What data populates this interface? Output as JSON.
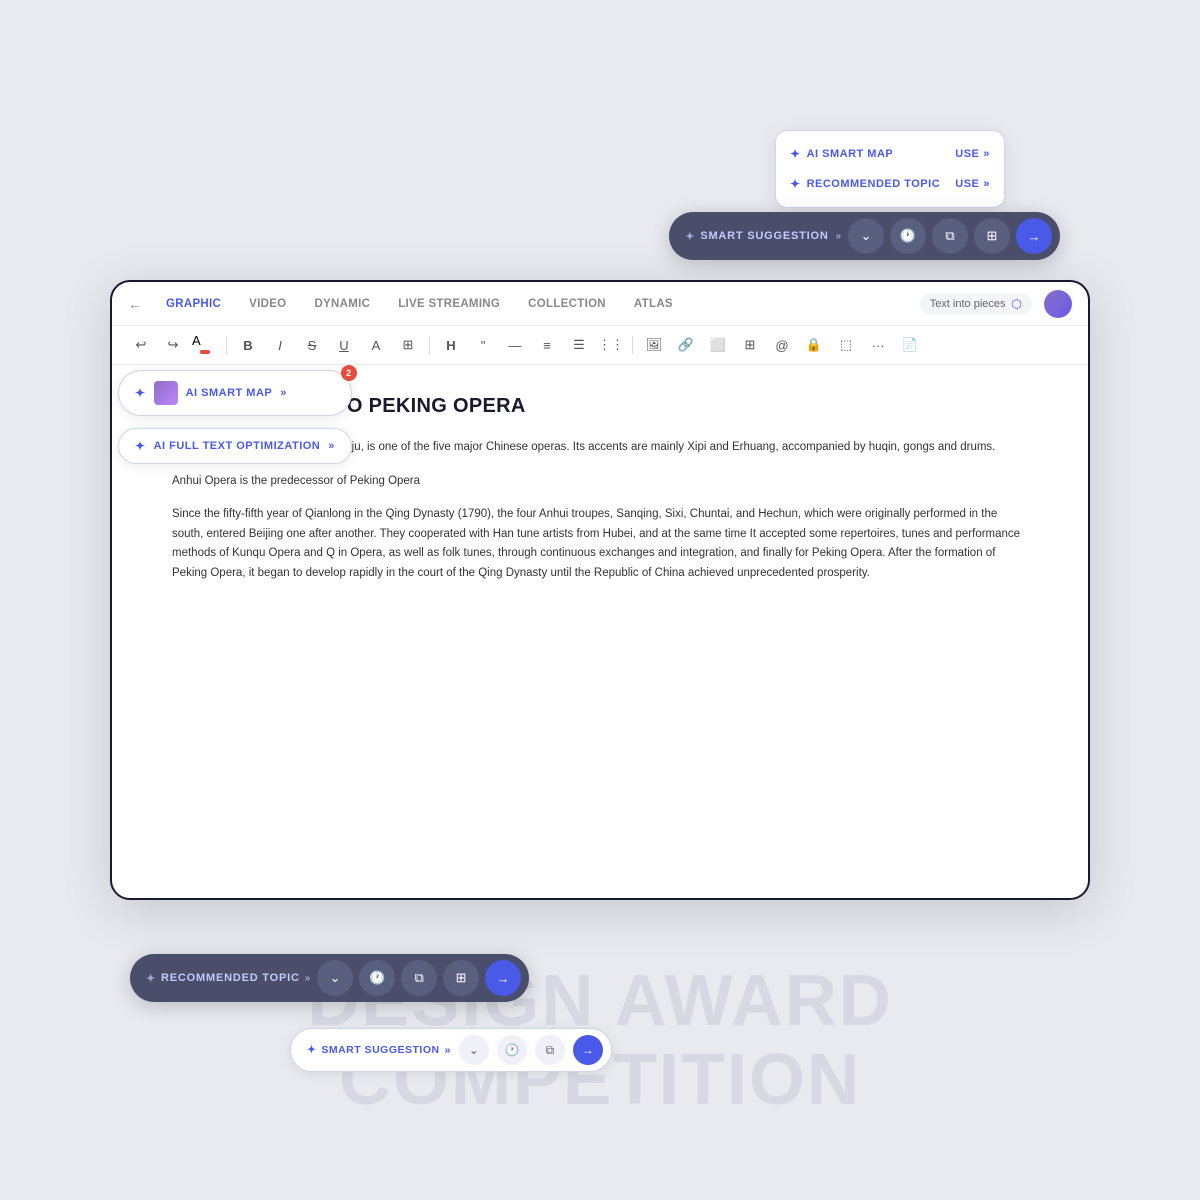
{
  "watermark": {
    "line1": "DESIGN AWARD",
    "line2": "COMPETITION"
  },
  "floating_panel_top": {
    "items": [
      {
        "label": "AI SMART MAP",
        "action": "USE"
      },
      {
        "label": "RECOMMENDED TOPIC",
        "action": "USE"
      }
    ]
  },
  "smart_bar_top": {
    "label": "✦ SMART SUGGESTION",
    "chevrons": "»"
  },
  "editor": {
    "nav_tabs": [
      {
        "label": "GRAPHIC",
        "active": true
      },
      {
        "label": "VIDEO",
        "active": false
      },
      {
        "label": "DYNAMIC",
        "active": false
      },
      {
        "label": "LIVE STREAMING",
        "active": false
      },
      {
        "label": "COLLECTION",
        "active": false
      },
      {
        "label": "ATLAS",
        "active": false
      }
    ],
    "text_into_pieces": "Text into pieces",
    "title": "INTRODUCTION TO PEKING OPERA",
    "paragraphs": [
      "Peking Opera, once known as Pingju, is one of the five major Chinese operas. Its accents are mainly Xipi and Erhuang, accompanied by huqin, gongs and drums.",
      "Anhui Opera is the predecessor of Peking Opera",
      "Since the fifty-fifth year of Qianlong in the Qing Dynasty (1790), the four Anhui troupes, Sanqing, Sixi, Chuntai, and Hechun, which were originally performed in the south, entered Beijing one after another. They cooperated with Han tune artists from Hubei, and at the same time It accepted some repertoires, tunes and performance methods of Kunqu Opera and Q in Opera, as well as folk tunes, through continuous exchanges and integration, and finally for Peking Opera. After the formation of Peking Opera, it began to develop rapidly in the court of the Qing Dynasty until the Republic of China achieved unprecedented prosperity."
    ]
  },
  "left_buttons": [
    {
      "label": "AI SMART MAP",
      "has_badge": true,
      "badge_count": "2",
      "has_thumb": true
    },
    {
      "label": "AI FULL TEXT OPTIMIZATION",
      "has_badge": false,
      "has_thumb": false
    }
  ],
  "bottom_bar": {
    "label": "✦ RECOMMENDED TOPIC",
    "chevrons": "»"
  },
  "bottom_smart_bar": {
    "label": "✦ SMART SUGGESTION",
    "chevrons": "»"
  },
  "toolbar": {
    "buttons": [
      "↩",
      "↪",
      "🎨",
      "B",
      "I",
      "S",
      "U",
      "A",
      "⊞",
      "H",
      "❝",
      "—",
      "≡",
      "☰",
      "⋮⋮",
      "🖼",
      "🔗",
      "⬜",
      "⊞",
      "👤",
      "🔒",
      "⬚",
      "···",
      "📄"
    ]
  }
}
